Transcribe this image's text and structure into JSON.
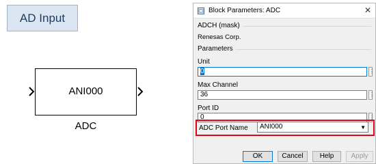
{
  "canvas": {
    "annotation": "AD Input",
    "block_text": "ANI000",
    "block_name": "ADC"
  },
  "dialog": {
    "title": "Block Parameters: ADC",
    "mask_header": "ADCH (mask)",
    "vendor": "Renesas Corp.",
    "parameters_header": "Parameters",
    "fields": [
      {
        "label": "Unit",
        "value": "0"
      },
      {
        "label": "Max Channel",
        "value": "36"
      },
      {
        "label": "Port ID",
        "value": "0"
      }
    ],
    "adc_port_label": "ADC Port Name",
    "adc_port_value": "ANI000",
    "buttons": {
      "ok": "OK",
      "cancel": "Cancel",
      "help": "Help",
      "apply": "Apply"
    }
  },
  "colors": {
    "highlight": "#e3001b",
    "focus": "#0078d7",
    "annotation_bg": "#dce6f3"
  }
}
